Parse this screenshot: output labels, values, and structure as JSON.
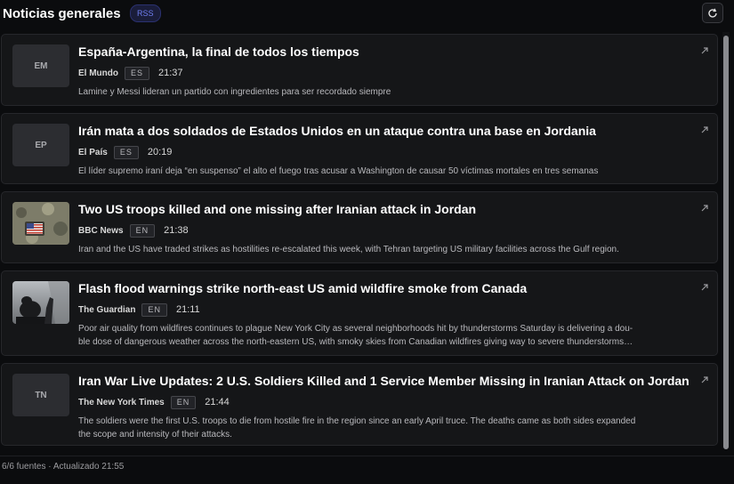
{
  "header": {
    "title": "Noticias generales",
    "badge": "RSS",
    "refresh_icon": "refresh-icon"
  },
  "articles": [
    {
      "thumb_text": "EM",
      "headline": "España-Argentina, la final de todos los tiempos",
      "source": "El Mundo",
      "lang": "ES",
      "time": "21:37",
      "summary": "Lamine y Messi lideran un partido con ingredientes para ser recordado siempre"
    },
    {
      "thumb_text": "EP",
      "headline": "Irán mata a dos soldados de Estados Unidos en un ataque contra una base en Jordania",
      "source": "El País",
      "lang": "ES",
      "time": "20:19",
      "summary": "El líder supremo iraní deja “en suspenso” el alto el fuego tras acusar a Washington de causar 50 víctimas mortales en tres semanas"
    },
    {
      "thumb_image": "soldier-flag-patch-photo",
      "headline": "Two US troops killed and one missing after Iranian attack in Jordan",
      "source": "BBC News",
      "lang": "EN",
      "time": "21:38",
      "summary": "Iran and the US have traded strikes as hostilities re-escalated this week, with Tehran targeting US military facilities across the Gulf region."
    },
    {
      "thumb_image": "smoky-sky-silhouette-photo",
      "headline": "Flash flood warnings strike north-east US amid wildfire smoke from Canada",
      "source": "The Guardian",
      "lang": "EN",
      "time": "21:11",
      "summary_line1": "Poor air quality from wildfires continues to plague New York City as several neighborhoods hit by thunderstorms Saturday is delivering a dou-",
      "summary_line2": "ble dose of dangerous weather across the north-eastern US, with smoky skies from Canadian wildfires giving way to severe thunderstorms…"
    },
    {
      "thumb_text": "TN",
      "headline": "Iran War Live Updates: 2 U.S. Soldiers Killed and 1 Service Member Missing in Iranian Attack on Jordan",
      "source": "The New York Times",
      "lang": "EN",
      "time": "21:44",
      "summary_line1": "The soldiers were the first U.S. troops to die from hostile fire in the region since an early April truce. The deaths came as both sides expanded",
      "summary_line2": "the scope and intensity of their attacks."
    }
  ],
  "footer": {
    "status": "6/6 fuentes · Actualizado 21:55"
  },
  "colors": {
    "background": "#0b0c0e",
    "card": "#151618",
    "badge_accent": "#6e7ef0"
  }
}
